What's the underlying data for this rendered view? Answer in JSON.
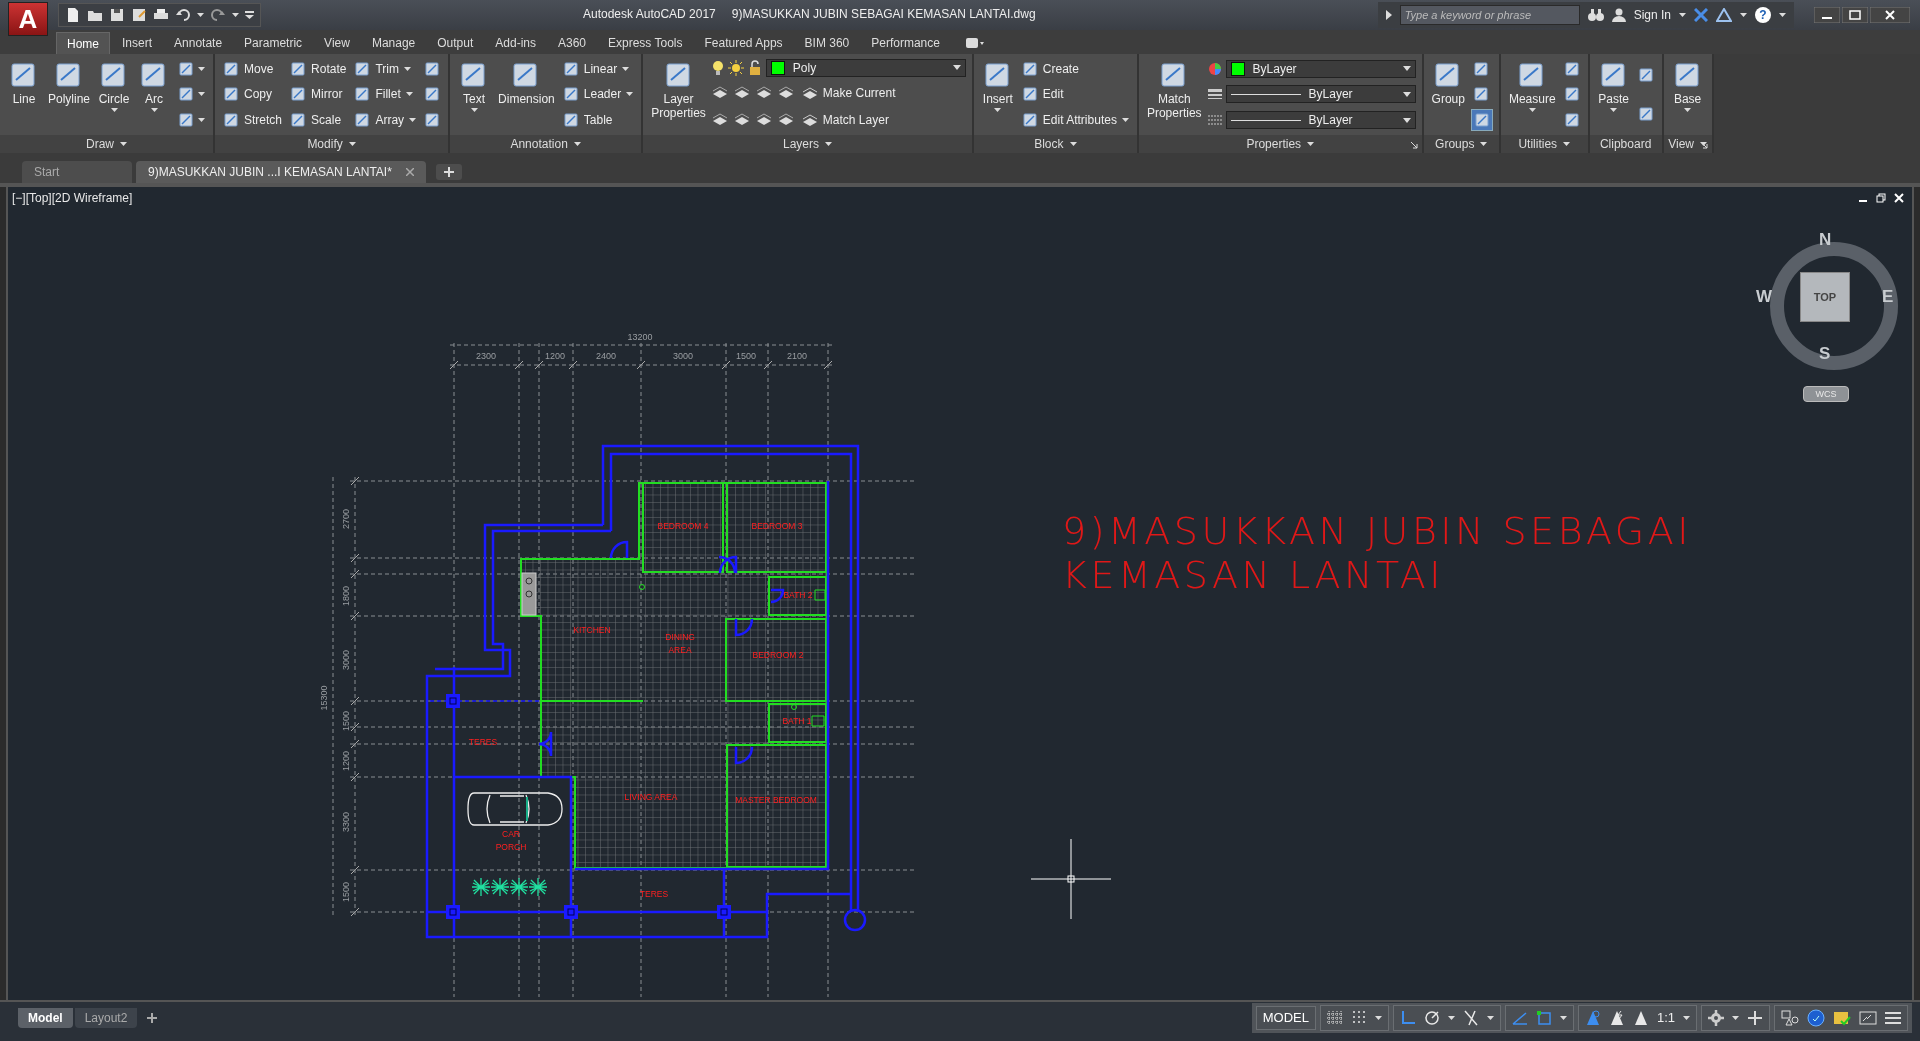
{
  "title_bar": {
    "app_button": "A",
    "app": "Autodesk AutoCAD 2017",
    "document": "9)MASUKKAN JUBIN SEBAGAI KEMASAN LANTAI.dwg",
    "search_placeholder": "Type a keyword or phrase",
    "sign_in": "Sign In",
    "help": "?"
  },
  "ribbon_tabs": [
    {
      "label": "Home",
      "selected": true
    },
    {
      "label": "Insert",
      "selected": false
    },
    {
      "label": "Annotate",
      "selected": false
    },
    {
      "label": "Parametric",
      "selected": false
    },
    {
      "label": "View",
      "selected": false
    },
    {
      "label": "Manage",
      "selected": false
    },
    {
      "label": "Output",
      "selected": false
    },
    {
      "label": "Add-ins",
      "selected": false
    },
    {
      "label": "A360",
      "selected": false
    },
    {
      "label": "Express Tools",
      "selected": false
    },
    {
      "label": "Featured Apps",
      "selected": false
    },
    {
      "label": "BIM 360",
      "selected": false
    },
    {
      "label": "Performance",
      "selected": false
    }
  ],
  "panels": [
    {
      "title": "Draw",
      "menu": true,
      "launcher": false,
      "columns": [
        [
          {
            "kind": "large",
            "label": "Line",
            "dropdown": false
          }
        ],
        [
          {
            "kind": "large",
            "label": "Polyline",
            "dropdown": false
          }
        ],
        [
          {
            "kind": "large",
            "label": "Circle",
            "dropdown": true
          }
        ],
        [
          {
            "kind": "large",
            "label": "Arc",
            "dropdown": true
          }
        ],
        [
          {
            "kind": "icon",
            "dropdown": true,
            "on": false
          },
          {
            "kind": "icon",
            "dropdown": true,
            "on": false
          },
          {
            "kind": "icon",
            "dropdown": true,
            "on": false
          }
        ]
      ]
    },
    {
      "title": "Modify",
      "menu": true,
      "launcher": false,
      "columns": [
        [
          {
            "kind": "small",
            "label": "Move",
            "dropdown": false
          },
          {
            "kind": "small",
            "label": "Copy",
            "dropdown": false
          },
          {
            "kind": "small",
            "label": "Stretch",
            "dropdown": false
          }
        ],
        [
          {
            "kind": "small",
            "label": "Rotate",
            "dropdown": false
          },
          {
            "kind": "small",
            "label": "Mirror",
            "dropdown": false
          },
          {
            "kind": "small",
            "label": "Scale",
            "dropdown": false
          }
        ],
        [
          {
            "kind": "small",
            "label": "Trim",
            "dropdown": true
          },
          {
            "kind": "small",
            "label": "Fillet",
            "dropdown": true
          },
          {
            "kind": "small",
            "label": "Array",
            "dropdown": true
          }
        ],
        [
          {
            "kind": "icon",
            "dropdown": false,
            "on": false
          },
          {
            "kind": "icon",
            "dropdown": false,
            "on": false
          },
          {
            "kind": "icon",
            "dropdown": false,
            "on": false
          }
        ]
      ]
    },
    {
      "title": "Annotation",
      "menu": true,
      "launcher": false,
      "columns": [
        [
          {
            "kind": "large",
            "label": "Text",
            "dropdown": true
          }
        ],
        [
          {
            "kind": "large",
            "label": "Dimension",
            "dropdown": false
          }
        ],
        [
          {
            "kind": "small",
            "label": "Linear",
            "dropdown": true
          },
          {
            "kind": "small",
            "label": "Leader",
            "dropdown": true
          },
          {
            "kind": "small",
            "label": "Table",
            "dropdown": false
          }
        ]
      ]
    },
    {
      "title": "Layers",
      "menu": true,
      "launcher": false,
      "columns": [
        [
          {
            "kind": "large",
            "label": "Layer Properties",
            "dropdown": false
          }
        ],
        [
          {
            "kind": "combo",
            "value": "Poly",
            "color": "#00ff00"
          },
          {
            "kind": "layer-row",
            "label": "Make Current"
          },
          {
            "kind": "layer-row",
            "label": "Match Layer"
          }
        ]
      ]
    },
    {
      "title": "Block",
      "menu": true,
      "launcher": false,
      "columns": [
        [
          {
            "kind": "large",
            "label": "Insert",
            "dropdown": true
          }
        ],
        [
          {
            "kind": "small",
            "label": "Create",
            "dropdown": false
          },
          {
            "kind": "small",
            "label": "Edit",
            "dropdown": false
          },
          {
            "kind": "small",
            "label": "Edit Attributes",
            "dropdown": true
          }
        ]
      ]
    },
    {
      "title": "Properties",
      "menu": true,
      "launcher": true,
      "columns": [
        [
          {
            "kind": "large",
            "label": "Match Properties",
            "dropdown": false
          }
        ],
        [
          {
            "kind": "combo",
            "value": "ByLayer",
            "color": "#00ff00"
          },
          {
            "kind": "combo-line",
            "value": "ByLayer"
          },
          {
            "kind": "combo-line",
            "value": "ByLayer"
          }
        ]
      ]
    },
    {
      "title": "Groups",
      "menu": true,
      "launcher": false,
      "columns": [
        [
          {
            "kind": "large",
            "label": "Group",
            "dropdown": false
          }
        ],
        [
          {
            "kind": "icon",
            "dropdown": false,
            "on": false
          },
          {
            "kind": "icon",
            "dropdown": false,
            "on": false
          },
          {
            "kind": "icon",
            "dropdown": false,
            "on": true
          }
        ]
      ]
    },
    {
      "title": "Utilities",
      "menu": true,
      "launcher": false,
      "columns": [
        [
          {
            "kind": "large",
            "label": "Measure",
            "dropdown": true
          }
        ],
        [
          {
            "kind": "icon",
            "dropdown": false,
            "on": false
          },
          {
            "kind": "icon",
            "dropdown": false,
            "on": false
          },
          {
            "kind": "icon",
            "dropdown": false,
            "on": false
          }
        ]
      ]
    },
    {
      "title": "Clipboard",
      "menu": false,
      "launcher": false,
      "columns": [
        [
          {
            "kind": "large",
            "label": "Paste",
            "dropdown": true
          }
        ],
        [
          {
            "kind": "icon",
            "dropdown": false,
            "on": false
          },
          {
            "kind": "icon",
            "dropdown": false,
            "on": false
          }
        ]
      ]
    },
    {
      "title": "View",
      "menu": true,
      "launcher": true,
      "columns": [
        [
          {
            "kind": "large",
            "label": "Base",
            "dropdown": true
          }
        ]
      ]
    }
  ],
  "document_tabs": [
    {
      "label": "Start",
      "selected": false
    },
    {
      "label": "9)MASUKKAN JUBIN ...I KEMASAN LANTAI*",
      "selected": true
    }
  ],
  "viewport": {
    "controls": "[−][Top][2D Wireframe]",
    "viewcube": {
      "face": "TOP",
      "north": "N",
      "south": "S",
      "east": "E",
      "west": "W",
      "ucs": "WCS"
    },
    "annotation": [
      "9)MASUKKAN JUBIN SEBAGAI",
      "KEMASAN LANTAI"
    ],
    "plan": {
      "dimensions_top": [
        {
          "text": "13200"
        },
        {
          "text": "2300"
        },
        {
          "text": "1200"
        },
        {
          "text": "2400"
        },
        {
          "text": "3000"
        },
        {
          "text": "1500"
        },
        {
          "text": "2100"
        }
      ],
      "dimensions_left": [
        {
          "text": "2700"
        },
        {
          "text": "1800"
        },
        {
          "text": "3000"
        },
        {
          "text": "1500"
        },
        {
          "text": "1200"
        },
        {
          "text": "3300"
        },
        {
          "text": "1500"
        },
        {
          "text": "15300"
        }
      ],
      "rooms": [
        {
          "lines": [
            "BEDROOM 4"
          ]
        },
        {
          "lines": [
            "BEDROOM 3"
          ]
        },
        {
          "lines": [
            "BATH 2"
          ]
        },
        {
          "lines": [
            "KITCHEN"
          ]
        },
        {
          "lines": [
            "DINING",
            "AREA"
          ]
        },
        {
          "lines": [
            "BEDROOM 2"
          ]
        },
        {
          "lines": [
            "BATH 1"
          ]
        },
        {
          "lines": [
            "TERES"
          ]
        },
        {
          "lines": [
            "LIVING AREA"
          ]
        },
        {
          "lines": [
            "MASTER BEDROOM"
          ]
        },
        {
          "lines": [
            "CAR",
            "PORCH"
          ]
        },
        {
          "lines": [
            "TERES"
          ]
        }
      ]
    }
  },
  "layout_tabs": [
    {
      "label": "Model",
      "selected": true
    },
    {
      "label": "Layout2",
      "selected": false
    }
  ],
  "status_bar": {
    "space": "MODEL",
    "scale": "1:1",
    "toggles": [
      {
        "on": false
      },
      {
        "on": false
      },
      {
        "on": true
      },
      {
        "on": false
      },
      {
        "on": false
      },
      {
        "on": true
      },
      {
        "on": true
      },
      {
        "on": true
      },
      {
        "on": false
      },
      {
        "on": false
      }
    ]
  }
}
